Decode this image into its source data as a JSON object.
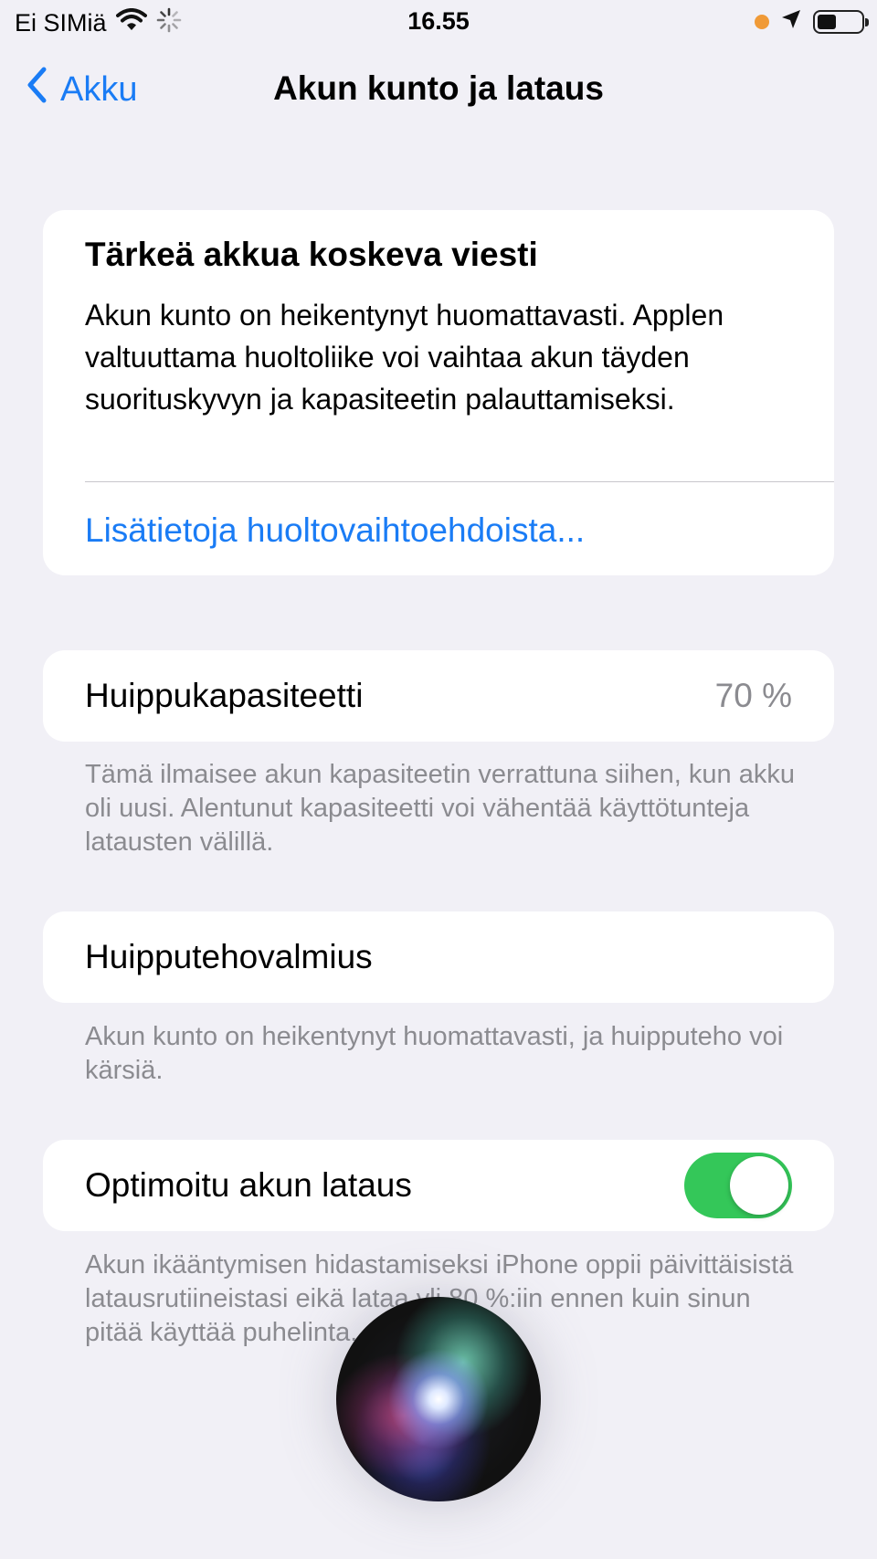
{
  "status_bar": {
    "carrier": "Ei SIMiä",
    "time": "16.55",
    "battery_level": 0.45
  },
  "nav": {
    "back_label": "Akku",
    "title": "Akun kunto ja lataus"
  },
  "important_message": {
    "title": "Tärkeä akkua koskeva viesti",
    "body": "Akun kunto on heikentynyt huomattavasti. Applen valtuuttama huoltoliike voi vaihtaa akun täyden suorituskyvyn ja kapasiteetin palauttamiseksi.",
    "link": "Lisätietoja huoltovaihtoehdoista..."
  },
  "capacity": {
    "label": "Huippukapasiteetti",
    "value": "70 %",
    "footnote": "Tämä ilmaisee akun kapasiteetin verrattuna siihen, kun akku oli uusi. Alentunut kapasiteetti voi vähentää käyttötunteja latausten välillä."
  },
  "peak_performance": {
    "label": "Huipputehovalmius",
    "footnote": "Akun kunto on heikentynyt huomattavasti, ja huipputeho voi kärsiä."
  },
  "optimized_charging": {
    "label": "Optimoitu akun lataus",
    "enabled": true,
    "footnote": "Akun ikääntymisen hidastamiseksi iPhone oppii päivittäisistä latausrutiineistasi eikä lataa yli 80 %:iin ennen kuin sinun pitää käyttää puhelinta."
  },
  "colors": {
    "accent": "#1a7cf5",
    "toggle_on": "#34c759",
    "background": "#f1f0f6"
  }
}
